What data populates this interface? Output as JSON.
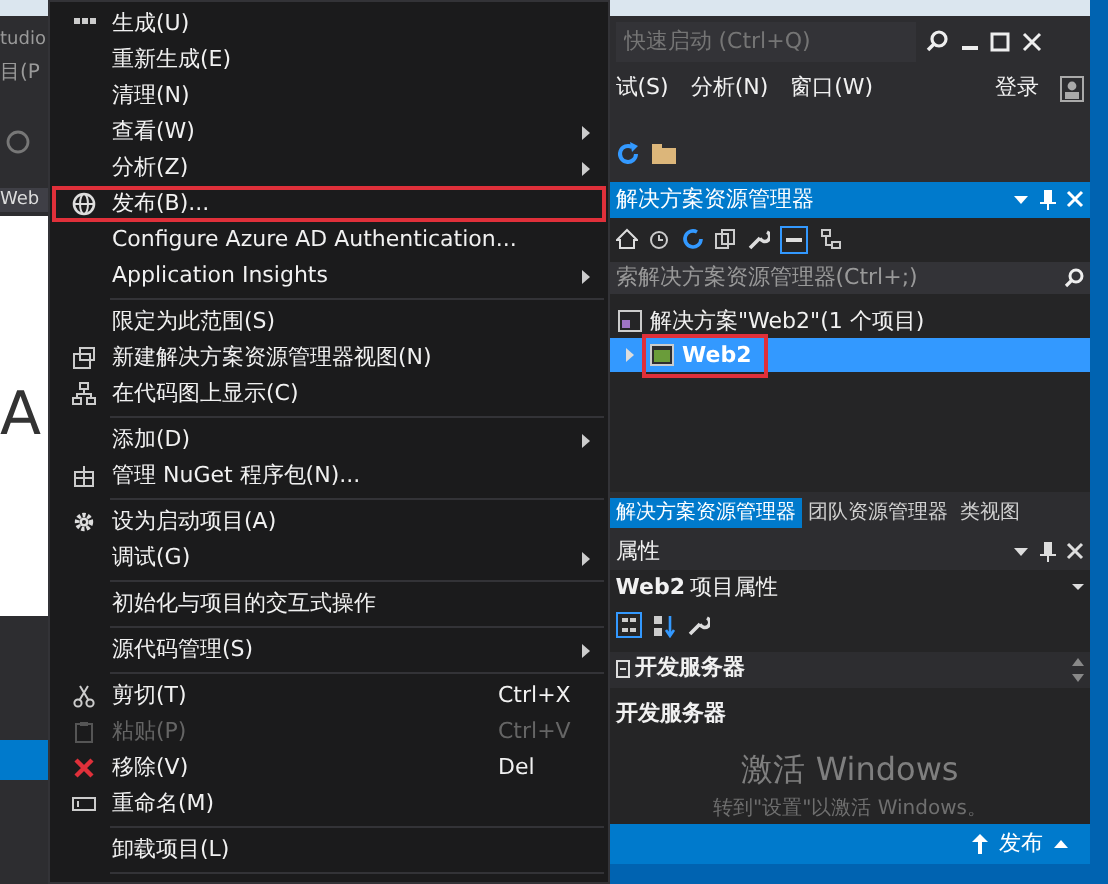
{
  "left_window": {
    "title_fragment": "tudio",
    "menu_fragment": "目(P",
    "tab_fragment": "Web",
    "editor_text": "A"
  },
  "context_menu": {
    "items": [
      {
        "kind": "item",
        "label": "生成(U)",
        "submenu": false,
        "disabled": false,
        "outlined": false
      },
      {
        "kind": "item",
        "label": "重新生成(E)",
        "submenu": false,
        "disabled": false,
        "outlined": false
      },
      {
        "kind": "item",
        "label": "清理(N)",
        "submenu": false,
        "disabled": false,
        "outlined": false
      },
      {
        "kind": "item",
        "label": "查看(W)",
        "submenu": true,
        "disabled": false,
        "outlined": false
      },
      {
        "kind": "item",
        "label": "分析(Z)",
        "submenu": true,
        "disabled": false,
        "outlined": false
      },
      {
        "kind": "item",
        "label": "发布(B)...",
        "submenu": false,
        "disabled": false,
        "outlined": true
      },
      {
        "kind": "item",
        "label": "Configure Azure AD Authentication...",
        "submenu": false,
        "disabled": false,
        "outlined": false
      },
      {
        "kind": "item",
        "label": "Application Insights",
        "submenu": true,
        "disabled": false,
        "outlined": false
      },
      {
        "kind": "separator"
      },
      {
        "kind": "item",
        "label": "限定为此范围(S)",
        "submenu": false,
        "disabled": false,
        "outlined": false
      },
      {
        "kind": "item",
        "label": "新建解决方案资源管理器视图(N)",
        "submenu": false,
        "disabled": false,
        "outlined": false
      },
      {
        "kind": "item",
        "label": "在代码图上显示(C)",
        "submenu": false,
        "disabled": false,
        "outlined": false
      },
      {
        "kind": "separator"
      },
      {
        "kind": "item",
        "label": "添加(D)",
        "submenu": true,
        "disabled": false,
        "outlined": false
      },
      {
        "kind": "item",
        "label": "管理 NuGet 程序包(N)...",
        "submenu": false,
        "disabled": false,
        "outlined": false
      },
      {
        "kind": "separator"
      },
      {
        "kind": "item",
        "label": "设为启动项目(A)",
        "submenu": false,
        "disabled": false,
        "outlined": false
      },
      {
        "kind": "item",
        "label": "调试(G)",
        "submenu": true,
        "disabled": false,
        "outlined": false
      },
      {
        "kind": "separator"
      },
      {
        "kind": "item",
        "label": "初始化与项目的交互式操作",
        "submenu": false,
        "disabled": false,
        "outlined": false
      },
      {
        "kind": "separator"
      },
      {
        "kind": "item",
        "label": "源代码管理(S)",
        "submenu": true,
        "disabled": false,
        "outlined": false
      },
      {
        "kind": "separator"
      },
      {
        "kind": "item",
        "label": "剪切(T)",
        "shortcut": "Ctrl+X",
        "submenu": false,
        "disabled": false,
        "outlined": false
      },
      {
        "kind": "item",
        "label": "粘贴(P)",
        "shortcut": "Ctrl+V",
        "submenu": false,
        "disabled": true,
        "outlined": false
      },
      {
        "kind": "item",
        "label": "移除(V)",
        "shortcut": "Del",
        "submenu": false,
        "disabled": false,
        "outlined": false
      },
      {
        "kind": "item",
        "label": "重命名(M)",
        "submenu": false,
        "disabled": false,
        "outlined": false
      },
      {
        "kind": "separator"
      },
      {
        "kind": "item",
        "label": "卸载项目(L)",
        "submenu": false,
        "disabled": false,
        "outlined": false
      },
      {
        "kind": "separator"
      }
    ]
  },
  "quick_launch": {
    "placeholder": "快速启动 (Ctrl+Q)"
  },
  "menu_bar": [
    "试(S)",
    "分析(N)",
    "窗口(W)"
  ],
  "sign_in": "登录",
  "solution_explorer": {
    "title": "解决方案资源管理器",
    "search_placeholder": "索解决方案资源管理器(Ctrl+;)",
    "tree": [
      {
        "label": "解决方案\"Web2\"(1 个项目)",
        "selected": false,
        "outlined": false,
        "children": [
          {
            "label": "Web2",
            "selected": true,
            "outlined": true
          }
        ]
      }
    ]
  },
  "panel_tabs": [
    {
      "label": "解决方案资源管理器",
      "selected": true
    },
    {
      "label": "团队资源管理器",
      "selected": false
    },
    {
      "label": "类视图",
      "selected": false
    }
  ],
  "properties": {
    "title": "属性",
    "object_name": "Web2",
    "object_type": "项目属性",
    "category": "开发服务器",
    "description_title": "开发服务器"
  },
  "activation_notice": {
    "title": "激活 Windows",
    "hint": "转到\"设置\"以激活 Windows。"
  },
  "status_bar": {
    "publish": "发布"
  }
}
